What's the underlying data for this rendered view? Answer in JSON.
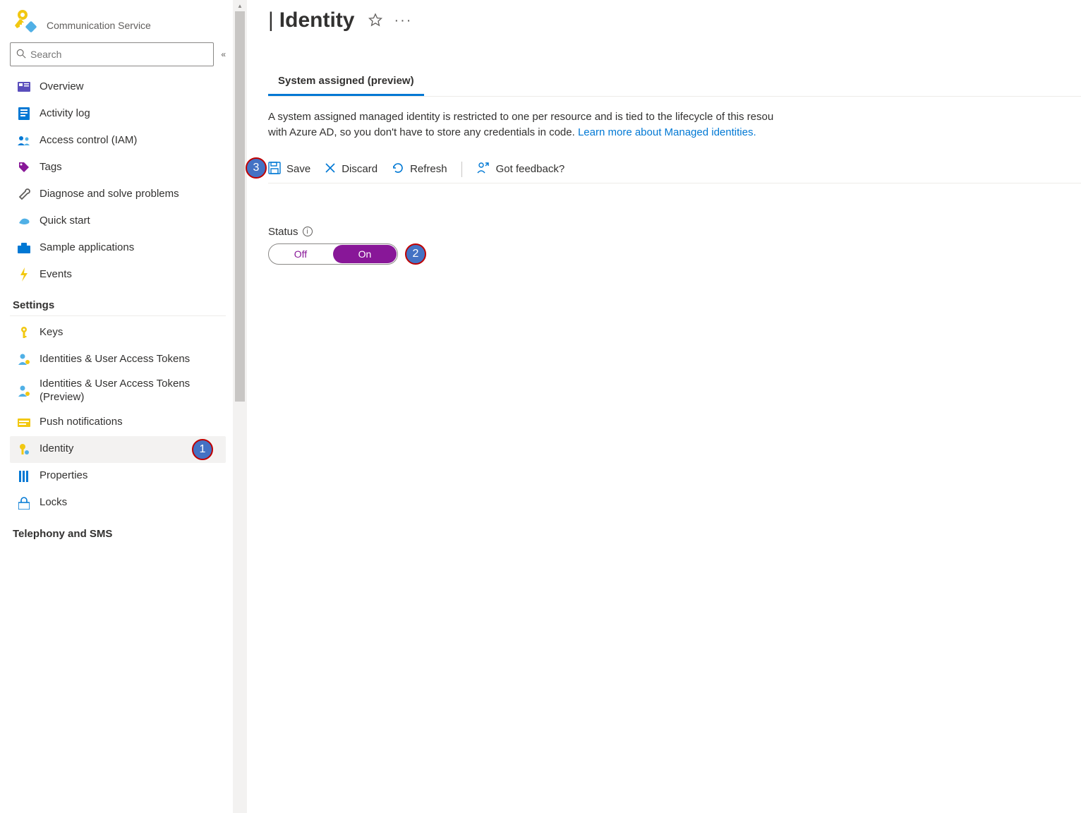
{
  "header": {
    "service_type": "Communication Service",
    "title_separator": "|",
    "title": "Identity"
  },
  "search": {
    "placeholder": "Search"
  },
  "sidebar": {
    "overview": "Overview",
    "activity_log": "Activity log",
    "access_control": "Access control (IAM)",
    "tags": "Tags",
    "diagnose": "Diagnose and solve problems",
    "quick_start": "Quick start",
    "sample_apps": "Sample applications",
    "events": "Events"
  },
  "sections": {
    "settings": "Settings",
    "telephony": "Telephony and SMS"
  },
  "settings_items": {
    "keys": "Keys",
    "identities": "Identities & User Access Tokens",
    "identities_preview": "Identities & User Access Tokens (Preview)",
    "push": "Push notifications",
    "identity": "Identity",
    "properties": "Properties",
    "locks": "Locks"
  },
  "tabs": {
    "system_assigned": "System assigned (preview)"
  },
  "description": {
    "text": "A system assigned managed identity is restricted to one per resource and is tied to the lifecycle of this resou… with Azure AD, so you don't have to store any credentials in code. ",
    "link": "Learn more about Managed identities.",
    "part1": "A system assigned managed identity is restricted to one per resource and is tied to the lifecycle of this resou",
    "part2": "with Azure AD, so you don't have to store any credentials in code."
  },
  "toolbar": {
    "save": "Save",
    "discard": "Discard",
    "refresh": "Refresh",
    "feedback": "Got feedback?"
  },
  "status": {
    "label": "Status",
    "off": "Off",
    "on": "On",
    "value": "On"
  },
  "callouts": {
    "1": "1",
    "2": "2",
    "3": "3"
  }
}
